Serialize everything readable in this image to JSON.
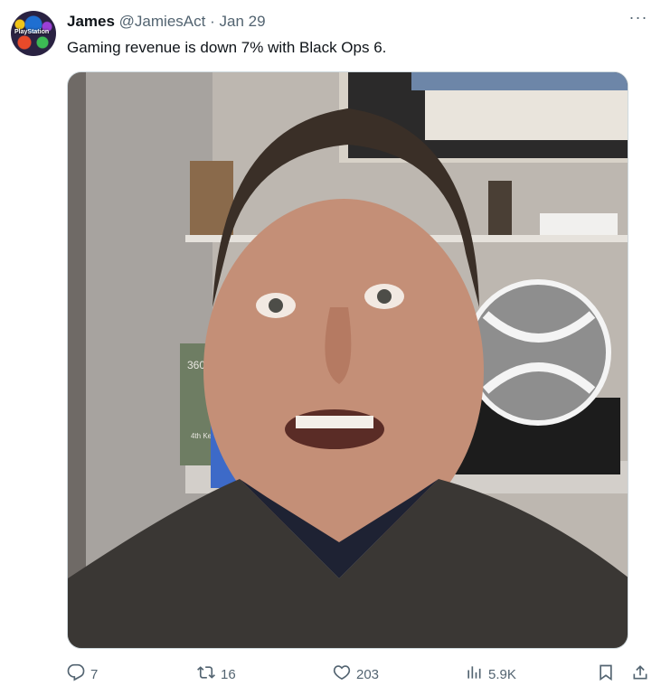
{
  "tweet": {
    "author_name": "James",
    "handle": "@JamiesAct",
    "separator": "·",
    "date": "Jan 29",
    "text": "Gaming revenue is down 7% with Black Ops 6.",
    "more_label": "···",
    "avatar_text": "PlayStation"
  },
  "media": {
    "poster_text_1": "360",
    "poster_text_2": "4th Ke"
  },
  "actions": {
    "replies": "7",
    "reposts": "16",
    "likes": "203",
    "views": "5.9K"
  }
}
